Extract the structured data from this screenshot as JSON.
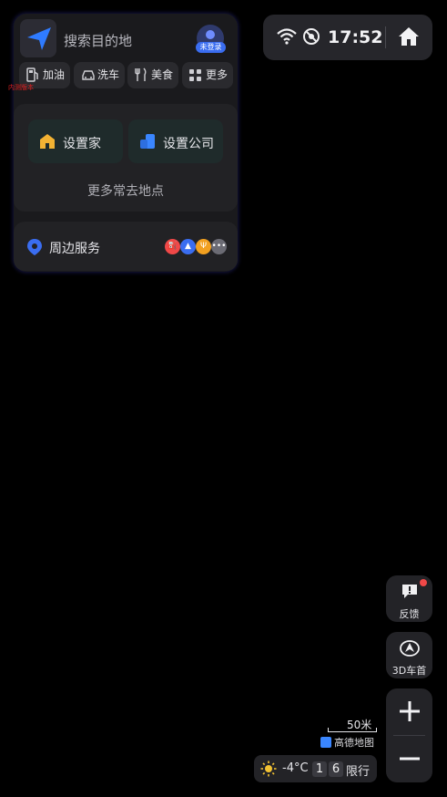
{
  "search": {
    "placeholder": "搜索目的地",
    "login_badge": "未登录"
  },
  "quick_chips": [
    {
      "label": "加油",
      "icon": "fuel-icon"
    },
    {
      "label": "洗车",
      "icon": "car-wash-icon"
    },
    {
      "label": "美食",
      "icon": "food-icon"
    },
    {
      "label": "更多",
      "icon": "grid-icon"
    }
  ],
  "small_tag": "内测版本",
  "favorites": {
    "home": "设置家",
    "company": "设置公司",
    "more": "更多常去地点"
  },
  "nearby": {
    "label": "周边服务",
    "icons": [
      "fuel-icon",
      "car-icon",
      "food-icon",
      "more-dots-icon"
    ]
  },
  "status": {
    "time": "17:52"
  },
  "side": {
    "feedback": "反馈",
    "view_mode": "3D车首"
  },
  "map": {
    "scale": "50米",
    "brand": "高德地图"
  },
  "weather": {
    "temp": "-4°C",
    "restriction_digits": [
      "1",
      "6"
    ],
    "restriction_label": "限行"
  },
  "colors": {
    "accent": "#3a6df0",
    "home": "#f2b233",
    "company": "#3a86ff",
    "alert": "#f04848"
  }
}
